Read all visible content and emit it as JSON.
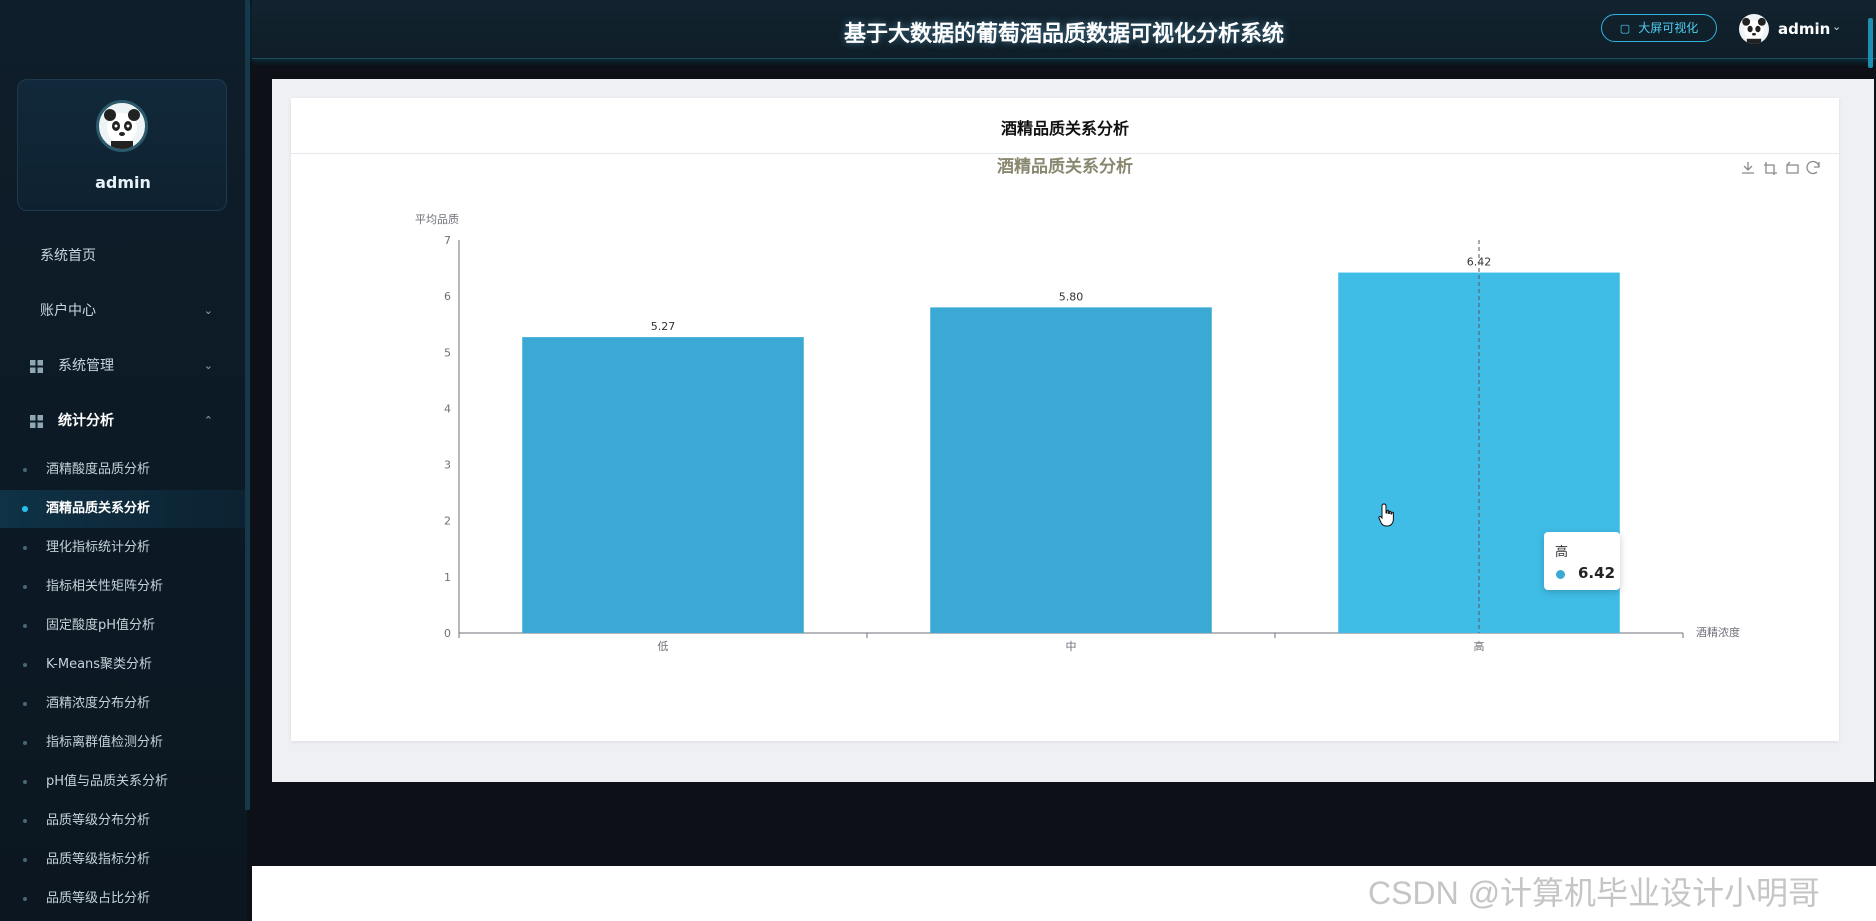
{
  "sidebar": {
    "profile_name": "admin",
    "menu": [
      {
        "label": "系统首页"
      },
      {
        "label": "账户中心"
      },
      {
        "label": "系统管理"
      },
      {
        "label": "统计分析"
      }
    ],
    "sub_items": [
      {
        "label": "酒精酸度品质分析"
      },
      {
        "label": "酒精品质关系分析"
      },
      {
        "label": "理化指标统计分析"
      },
      {
        "label": "指标相关性矩阵分析"
      },
      {
        "label": "固定酸度pH值分析"
      },
      {
        "label": "K-Means聚类分析"
      },
      {
        "label": "酒精浓度分布分析"
      },
      {
        "label": "指标离群值检测分析"
      },
      {
        "label": "pH值与品质关系分析"
      },
      {
        "label": "品质等级分布分析"
      },
      {
        "label": "品质等级指标分析"
      },
      {
        "label": "品质等级占比分析"
      }
    ],
    "active_sub_index": 1
  },
  "header": {
    "title": "基于大数据的葡萄酒品质数据可视化分析系统",
    "bigscreen_label": "大屏可视化",
    "user_name": "admin"
  },
  "card": {
    "title": "酒精品质关系分析"
  },
  "chart_data": {
    "type": "bar",
    "title": "酒精品质关系分析",
    "categories": [
      "低",
      "中",
      "高"
    ],
    "values": [
      5.27,
      5.8,
      6.42
    ],
    "value_labels": [
      "5.27",
      "5.80",
      "6.42"
    ],
    "xlabel": "酒精浓度",
    "ylabel": "平均品质",
    "ylim": [
      0,
      7
    ],
    "yticks": [
      0,
      1,
      2,
      3,
      4,
      5,
      6,
      7
    ],
    "grid": false,
    "bar_colors": [
      "#3aa9d4",
      "#3aa9d4",
      "#3fbde6"
    ],
    "title_color": "#8a8870"
  },
  "tooltip": {
    "name": "高",
    "value": "6.42"
  },
  "watermark": "CSDN @计算机毕业设计小明哥",
  "colors": {
    "accent": "#22c3ee",
    "sidebar_bg": "#0e1e2a"
  }
}
